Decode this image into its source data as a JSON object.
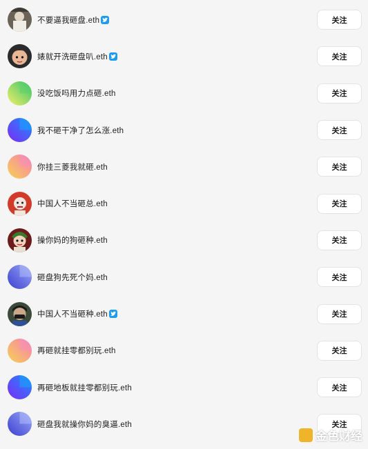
{
  "accounts": [
    {
      "name": "不要逼我砸盘.eth",
      "verified": true,
      "avatar": "photo-avatar-1"
    },
    {
      "name": "婊就开洗砸盘叭.eth",
      "verified": true,
      "avatar": "cartoon-avatar"
    },
    {
      "name": "没吃饭吗用力点砸.eth",
      "verified": false,
      "avatar": "gradient-green-avatar"
    },
    {
      "name": "我不砸干净了怎么涨.eth",
      "verified": false,
      "avatar": "gradient-blue-avatar"
    },
    {
      "name": "你挂三菱我就砸.eth",
      "verified": false,
      "avatar": "gradient-pink-avatar"
    },
    {
      "name": "中国人不当砸总.eth",
      "verified": false,
      "avatar": "red-cartoon-avatar"
    },
    {
      "name": "操你妈的狗砸种.eth",
      "verified": false,
      "avatar": "character-avatar"
    },
    {
      "name": "砸盘狗先死个妈.eth",
      "verified": false,
      "avatar": "gradient-indigo-avatar"
    },
    {
      "name": "中国人不当砸种",
      "verified": true,
      "avatar": "masked-face-avatar",
      "suffix": ".eth"
    },
    {
      "name": "再砸就挂零都别玩.eth",
      "verified": false,
      "avatar": "gradient-orange-pink-avatar"
    },
    {
      "name": "再砸地板就挂零都别玩.eth",
      "verified": false,
      "avatar": "gradient-blue-avatar-2"
    },
    {
      "name": "砸盘我就操你妈的臭逼.eth",
      "verified": false,
      "avatar": "gradient-indigo-avatar-2"
    }
  ],
  "follow_label": "关注",
  "watermark": {
    "text": "金色财经"
  },
  "colors": {
    "background": "#f5f5f5",
    "verified_badge": "#1d9bf0",
    "button_bg": "#ffffff",
    "logo": "#f0b429"
  }
}
